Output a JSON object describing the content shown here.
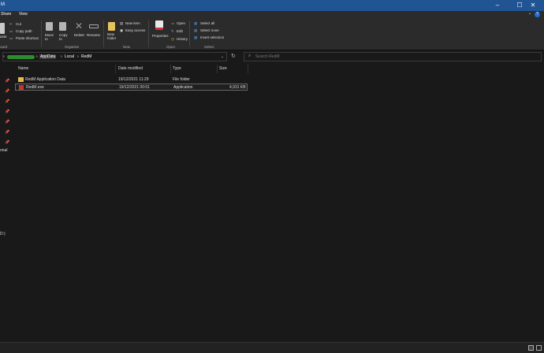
{
  "window": {
    "title_fragment": "M",
    "minimize": "–",
    "maximize": "☐",
    "close": "✕"
  },
  "menu": {
    "share": "Share",
    "view": "View",
    "chevron": "⌄",
    "help": "?"
  },
  "ribbon": {
    "clipboard": {
      "paste": "aste",
      "cut": "Cut",
      "copy_path": "Copy path",
      "paste_shortcut": "Paste shortcut",
      "group": "oard"
    },
    "organise": {
      "move_to": "Move\nto",
      "copy_to": "Copy\nto",
      "delete": "Delete",
      "rename": "Rename",
      "group": "Organise"
    },
    "new": {
      "new_folder": "New\nfolder",
      "new_item": "New item",
      "easy_access": "Easy access",
      "group": "New"
    },
    "open": {
      "properties": "Properties",
      "open": "Open",
      "edit": "Edit",
      "history": "History",
      "group": "Open"
    },
    "select": {
      "select_all": "Select all",
      "select_none": "Select none",
      "invert": "Invert selection",
      "group": "Select"
    }
  },
  "address": {
    "crumbs": [
      "AppData",
      "Local",
      "RedM"
    ],
    "sep": "›",
    "refresh": "↻"
  },
  "search": {
    "placeholder": "Search RedM"
  },
  "columns": {
    "name": "Name",
    "date": "Date modified",
    "type": "Type",
    "size": "Size"
  },
  "files": [
    {
      "name": "RedM Application Data",
      "date": "19/12/2021 11:29",
      "type": "File folder",
      "size": ""
    },
    {
      "name": "RedM.exe",
      "date": "19/12/2021 00:01",
      "type": "Application",
      "size": "4,931 KB"
    }
  ],
  "nav": {
    "pin": "📌",
    "item1": "onal",
    "item2": "D:)"
  },
  "colors": {
    "accent": "#205493",
    "folder": "#e8b84a",
    "exe": "#d0312d"
  }
}
